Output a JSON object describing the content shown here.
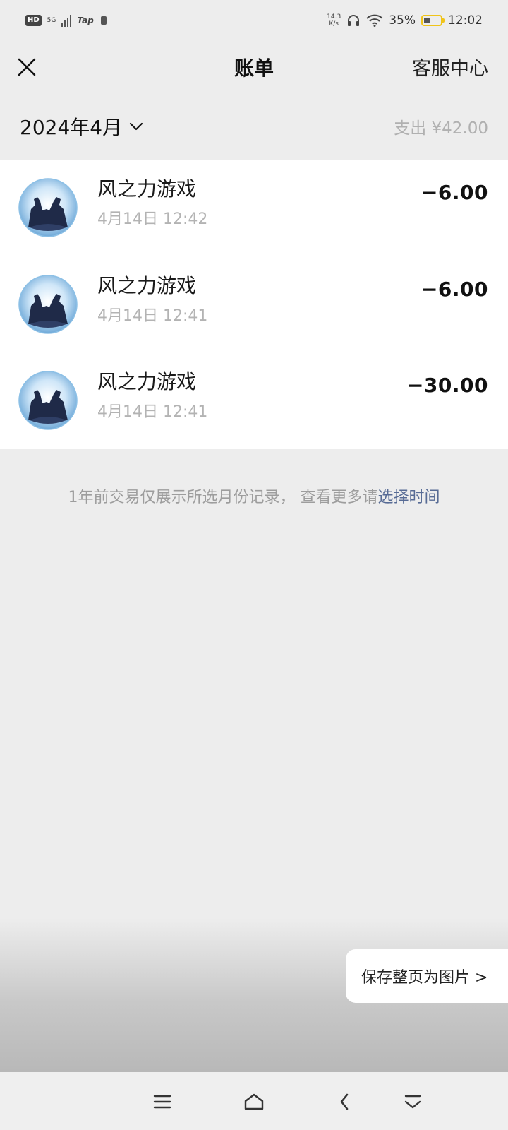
{
  "status_bar": {
    "hd": "HD",
    "network": "5G",
    "tap": "Tap",
    "speed_value": "14.3",
    "speed_unit": "K/s",
    "battery": "35%",
    "time": "12:02"
  },
  "header": {
    "title": "账单",
    "service_label": "客服中心"
  },
  "month_bar": {
    "month": "2024年4月",
    "total": "支出 ¥42.00"
  },
  "transactions": [
    {
      "name": "风之力游戏",
      "time": "4月14日 12:42",
      "amount": "−6.00"
    },
    {
      "name": "风之力游戏",
      "time": "4月14日 12:41",
      "amount": "−6.00"
    },
    {
      "name": "风之力游戏",
      "time": "4月14日 12:41",
      "amount": "−30.00"
    }
  ],
  "note": {
    "text": "1年前交易仅展示所选月份记录，  查看更多请",
    "link": "选择时间"
  },
  "save_button": {
    "label": "保存整页为图片 >"
  },
  "colors": {
    "page_bg": "#ededed",
    "link": "#576b95",
    "battery_outline": "#f0c419"
  },
  "icons": {
    "close": "close-icon",
    "chevron": "chevron-down-icon",
    "avatar": "game-avatar-icon",
    "menu": "menu-icon",
    "home": "home-icon",
    "back": "back-icon",
    "collapse": "collapse-icon"
  }
}
